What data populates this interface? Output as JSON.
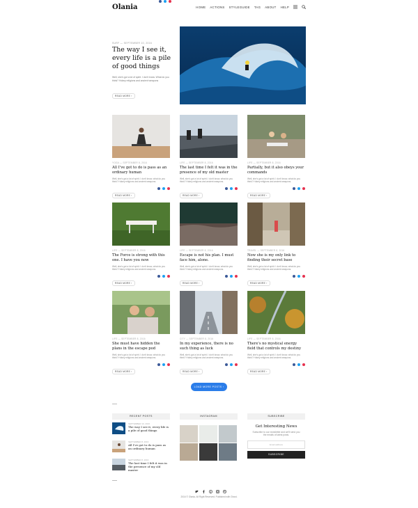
{
  "header": {
    "logo": "Olania",
    "nav": [
      "Home",
      "Actions",
      "Styleguide",
      "Tag",
      "About",
      "Help"
    ],
    "icons": [
      "menu-icon",
      "search-icon"
    ]
  },
  "hero": {
    "meta": "SURF — SEPTEMBER 10, 2016",
    "title": "The way I see it, every life is a pile of good things",
    "excerpt": "Well, she's got a lot of spirit. I don't know. What do you think? Hokey religions and ancient weapons",
    "more": "READ MORE ›"
  },
  "posts": [
    {
      "meta": "YOGA — SEPTEMBER 8, 2016",
      "title": "All I've got to do is pass as an ordinary human",
      "excerpt": "Well, she's got a lot of spirit. I don't know, what do you think? Hokey religions and ancient weapons.",
      "more": "READ MORE ›"
    },
    {
      "meta": "LIFE — SEPTEMBER 8, 2016",
      "title": "The last time I felt it was in the presence of my old master",
      "excerpt": "Well, she's got a lot of spirit. I don't know, what do you think? Hokey religions and ancient weapons.",
      "more": "READ MORE ›"
    },
    {
      "meta": "LIFE — SEPTEMBER 8, 2016",
      "title": "Partially, but it also obeys your commands",
      "excerpt": "Well, she's got a lot of spirit. I don't know, what do you think? Hokey religions and ancient weapons.",
      "more": "READ MORE ›"
    },
    {
      "meta": "LIFE — SEPTEMBER 8, 2016",
      "title": "The Force is strong with this one. I have you now",
      "excerpt": "Well, she's got a lot of spirit. I don't know, what do you think? Hokey religions and ancient weapons.",
      "more": "READ MORE ›"
    },
    {
      "meta": "LIFE — SEPTEMBER 8, 2016",
      "title": "Escape is not his plan. I must face him, alone.",
      "excerpt": "Well, she's got a lot of spirit. I don't know, what do you think? Hokey religions and ancient weapons.",
      "more": "READ MORE ›"
    },
    {
      "meta": "TRAVEL — SEPTEMBER 8, 2016",
      "title": "Now she is my only link to finding their secret base",
      "excerpt": "Well, she's got a lot of spirit. I don't know, what do you think? Hokey religions and ancient weapons.",
      "more": "READ MORE ›"
    },
    {
      "meta": "LIFE — SEPTEMBER 8, 2016",
      "title": "She must have hidden the plans in the escape pod",
      "excerpt": "Well, she's got a lot of spirit. I don't know, what do you think? Hokey religions and ancient weapons.",
      "more": "READ MORE ›"
    },
    {
      "meta": "CITY — SEPTEMBER 8, 2016",
      "title": "In my experience, there is no such thing as luck",
      "excerpt": "Well, she's got a lot of spirit. I don't know, what do you think? Hokey religions and ancient weapons.",
      "more": "READ MORE ›"
    },
    {
      "meta": "LIFE — SEPTEMBER 8, 2016",
      "title": "There's no mystical energy field that controls my destiny",
      "excerpt": "Well, she's got a lot of spirit. I don't know, what do you think? Hokey religions and ancient weapons.",
      "more": "READ MORE ›"
    }
  ],
  "load_more": "LOAD MORE POSTS ›",
  "widgets": {
    "recent": {
      "title": "RECENT POSTS",
      "items": [
        {
          "date": "SEPTEMBER 10, 2016",
          "title": "The way I see it, every life is a pile of good things"
        },
        {
          "date": "SEPTEMBER 8, 2016",
          "title": "All I've got to do is pass as an ordinary human"
        },
        {
          "date": "SEPTEMBER 8, 2016",
          "title": "The last time I felt it was in the presence of my old master"
        }
      ]
    },
    "instagram": {
      "title": "INSTAGRAM"
    },
    "subscribe": {
      "title": "SUBSCRIBE",
      "heading": "Get Interesting News",
      "text": "Subscribe to our newsletter and we'll send you the emails of latest posts.",
      "placeholder": "Email address",
      "button": "SUBSCRIBE"
    }
  },
  "footer": {
    "icons": [
      "twitter-icon",
      "facebook-icon",
      "pinterest-icon",
      "instagram-icon",
      "dribbble-icon"
    ],
    "copyright": "2016 © Olania. All Right Reserved. Published with Ghost."
  },
  "colors": {
    "accent": "#2b7de9",
    "facebook": "#3b5998",
    "twitter": "#1da1f2",
    "pinterest": "#e6324f"
  }
}
